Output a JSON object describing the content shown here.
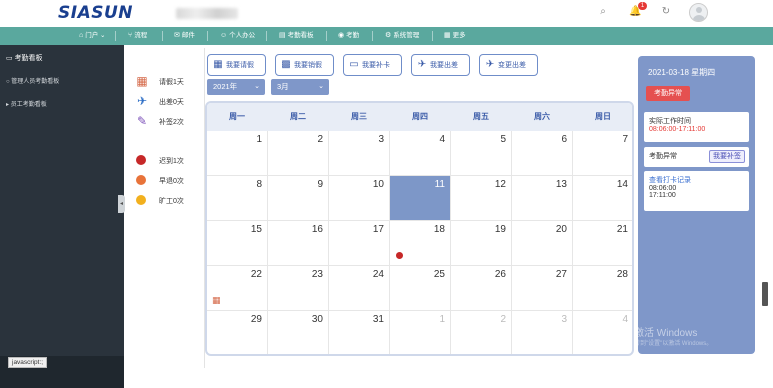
{
  "header": {
    "logo": "SIASUN",
    "notification_count": "1"
  },
  "nav": [
    {
      "label": "门户",
      "icon": "home-icon",
      "glyph": "⌂"
    },
    {
      "label": "流程",
      "icon": "flow-icon",
      "glyph": "⑂"
    },
    {
      "label": "邮件",
      "icon": "mail-icon",
      "glyph": "✉"
    },
    {
      "label": "个人办公",
      "icon": "person-icon",
      "glyph": "☺"
    },
    {
      "label": "考勤看板",
      "icon": "board-icon",
      "glyph": "▤"
    },
    {
      "label": "考勤",
      "icon": "location-icon",
      "glyph": "◉"
    },
    {
      "label": "系统管理",
      "icon": "settings-icon",
      "glyph": "⚙"
    },
    {
      "label": "更多",
      "icon": "grid-icon",
      "glyph": "▦"
    }
  ],
  "sidebar": {
    "title": "考勤看板",
    "items": [
      {
        "label": "管理人员考勤看板"
      },
      {
        "label": "员工考勤看板"
      }
    ]
  },
  "status_text": "javascript:;",
  "stats": [
    {
      "label": "请假1天",
      "icon": "leave-calendar-icon",
      "glyph": "🗓"
    },
    {
      "label": "出差0天",
      "icon": "plane-icon",
      "glyph": "✈"
    },
    {
      "label": "补签2次",
      "icon": "edit-icon",
      "glyph": "✎"
    },
    {
      "label": "迟到1次",
      "color": "#c62828"
    },
    {
      "label": "早退0次",
      "color": "#e8733a"
    },
    {
      "label": "旷工0次",
      "color": "#f2b01e"
    }
  ],
  "actions": [
    {
      "label": "我要请假",
      "icon": "calendar-icon",
      "glyph": "▦"
    },
    {
      "label": "我要销假",
      "icon": "calendar-cancel-icon",
      "glyph": "▩"
    },
    {
      "label": "我要补卡",
      "icon": "card-icon",
      "glyph": "▭"
    },
    {
      "label": "我要出差",
      "icon": "plane-icon",
      "glyph": "✈"
    },
    {
      "label": "变更出差",
      "icon": "plane-change-icon",
      "glyph": "✈"
    }
  ],
  "filters": {
    "year": "2021年",
    "month": "3月"
  },
  "calendar": {
    "weekdays": [
      "周一",
      "周二",
      "周三",
      "周四",
      "周五",
      "周六",
      "周日"
    ],
    "weeks": [
      [
        {
          "d": "1"
        },
        {
          "d": "2"
        },
        {
          "d": "3"
        },
        {
          "d": "4"
        },
        {
          "d": "5"
        },
        {
          "d": "6"
        },
        {
          "d": "7"
        }
      ],
      [
        {
          "d": "8"
        },
        {
          "d": "9"
        },
        {
          "d": "10"
        },
        {
          "d": "11",
          "today": true
        },
        {
          "d": "12"
        },
        {
          "d": "13"
        },
        {
          "d": "14"
        }
      ],
      [
        {
          "d": "15"
        },
        {
          "d": "16"
        },
        {
          "d": "17"
        },
        {
          "d": "18"
        },
        {
          "d": "19"
        },
        {
          "d": "20"
        },
        {
          "d": "21"
        }
      ],
      [
        {
          "d": "22"
        },
        {
          "d": "23"
        },
        {
          "d": "24"
        },
        {
          "d": "25"
        },
        {
          "d": "26"
        },
        {
          "d": "27"
        },
        {
          "d": "28"
        }
      ],
      [
        {
          "d": "29"
        },
        {
          "d": "30"
        },
        {
          "d": "31"
        },
        {
          "d": "1",
          "other": true
        },
        {
          "d": "2",
          "other": true
        },
        {
          "d": "3",
          "other": true
        },
        {
          "d": "4",
          "other": true
        }
      ]
    ]
  },
  "detail": {
    "date": "2021-03-18 星期四",
    "abnormal_button": "考勤异常",
    "actual_time_label": "实际工作时间",
    "actual_time_value": "08:06:00-17:11:00",
    "abnormal_label": "考勤异常",
    "supplement_button": "我要补签",
    "punch_record_link": "查看打卡记录",
    "punch_in": "08:06:00",
    "punch_out": "17:11:00"
  },
  "watermark": {
    "line1": "激活 Windows",
    "line2": "转到\"设置\"以激活 Windows。"
  }
}
